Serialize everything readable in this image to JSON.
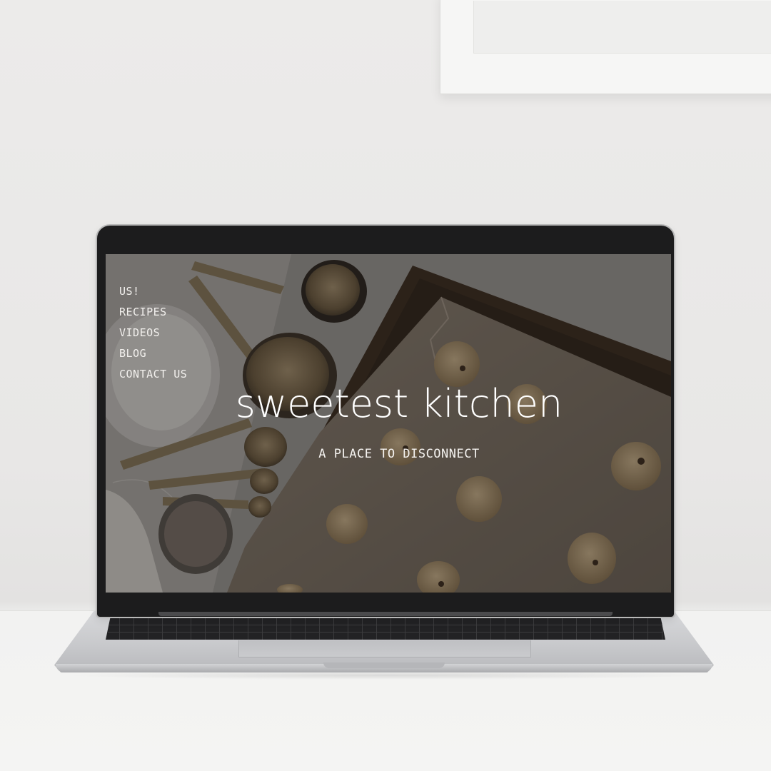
{
  "site": {
    "nav": [
      {
        "label": "US!"
      },
      {
        "label": "RECIPES"
      },
      {
        "label": "VIDEOS"
      },
      {
        "label": "BLOG"
      },
      {
        "label": "CONTACT US"
      }
    ],
    "title": "sweetest kitchen",
    "tagline": "A PLACE TO DISCONNECT"
  },
  "colors": {
    "wall": "#ecebea",
    "desk": "#f2f2f1",
    "bezel": "#1c1c1d",
    "screen_overlay": "#141210",
    "text": "#ffffff"
  }
}
